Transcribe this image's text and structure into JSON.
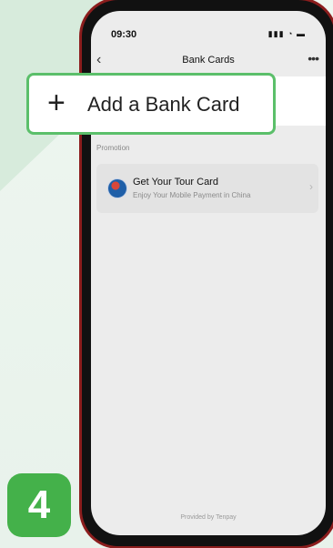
{
  "status_bar": {
    "time": "09:30",
    "icons": "signal wifi battery"
  },
  "nav": {
    "title": "Bank Cards"
  },
  "callout": {
    "label": "Add a Bank Card"
  },
  "promotion": {
    "section_label": "Promotion",
    "title": "Get Your Tour Card",
    "subtitle": "Enjoy Your Mobile Payment in China"
  },
  "footer": {
    "text": "Provided by Tenpay"
  },
  "step": {
    "number": "4"
  },
  "colors": {
    "accent_green": "#44b14a",
    "callout_border": "#5bbf6a",
    "phone_frame": "#8b1d1d"
  }
}
